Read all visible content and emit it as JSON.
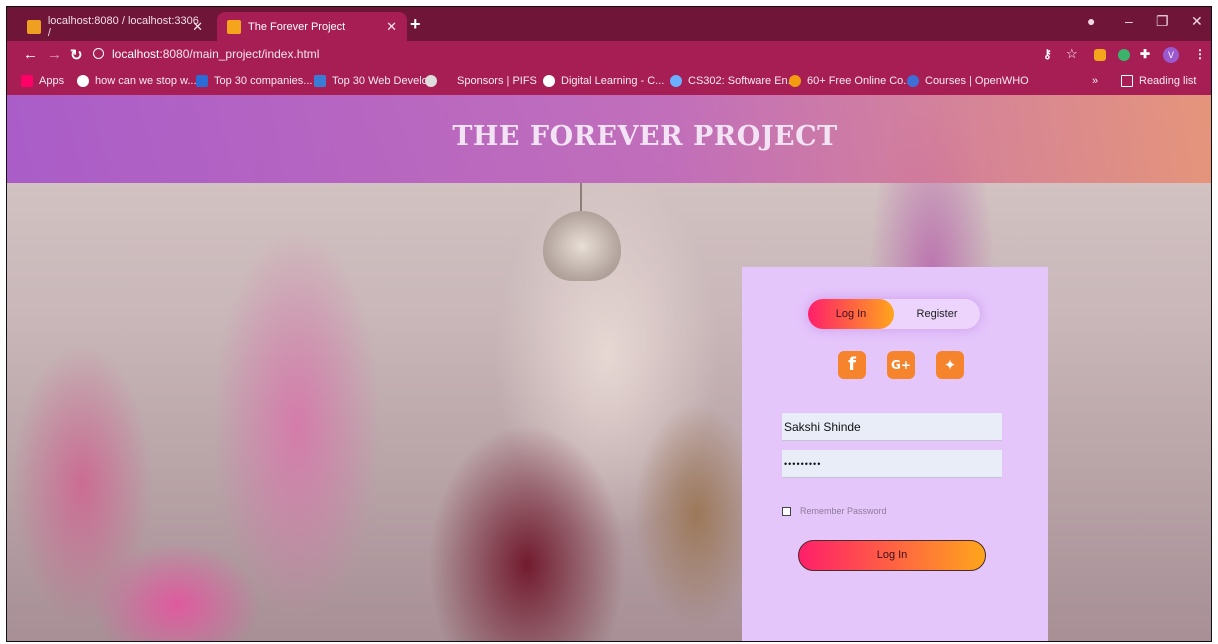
{
  "browser": {
    "tabs": [
      {
        "title": "localhost:8080 / localhost:3306 /",
        "fav_color": "#f0a020"
      },
      {
        "title": "The Forever Project",
        "fav_color": "#f4a51c"
      }
    ],
    "url_host": "localhost",
    "url_rest": ":8080/main_project/index.html",
    "profile_initial": "V",
    "bookmarks": [
      {
        "label": "Apps",
        "color": "#f06"
      },
      {
        "label": "how can we stop w...",
        "color": "#fff"
      },
      {
        "label": "Top 30 companies...",
        "color": "#2b6bd6"
      },
      {
        "label": "Top 30 Web Develo...",
        "color": "#3a7bd5"
      },
      {
        "label": "Sponsors | PIFS",
        "color": "#ddd"
      },
      {
        "label": "Digital Learning - C...",
        "color": "#fff"
      },
      {
        "label": "CS302: Software En...",
        "color": "#6ab0ff"
      },
      {
        "label": "60+ Free Online Co...",
        "color": "#f39c12"
      },
      {
        "label": "Courses | OpenWHO",
        "color": "#3d6fd6"
      }
    ],
    "reading_list": "Reading list",
    "more": "»"
  },
  "page": {
    "title": "THE FOREVER PROJECT",
    "login": {
      "tab_login": "Log In",
      "tab_register": "Register",
      "social": [
        "facebook-icon",
        "google-plus-icon",
        "twitter-icon"
      ],
      "username_value": "Sakshi Shinde",
      "password_value": "•••••••••",
      "remember_label": "Remember Password",
      "submit_label": "Log In"
    }
  }
}
